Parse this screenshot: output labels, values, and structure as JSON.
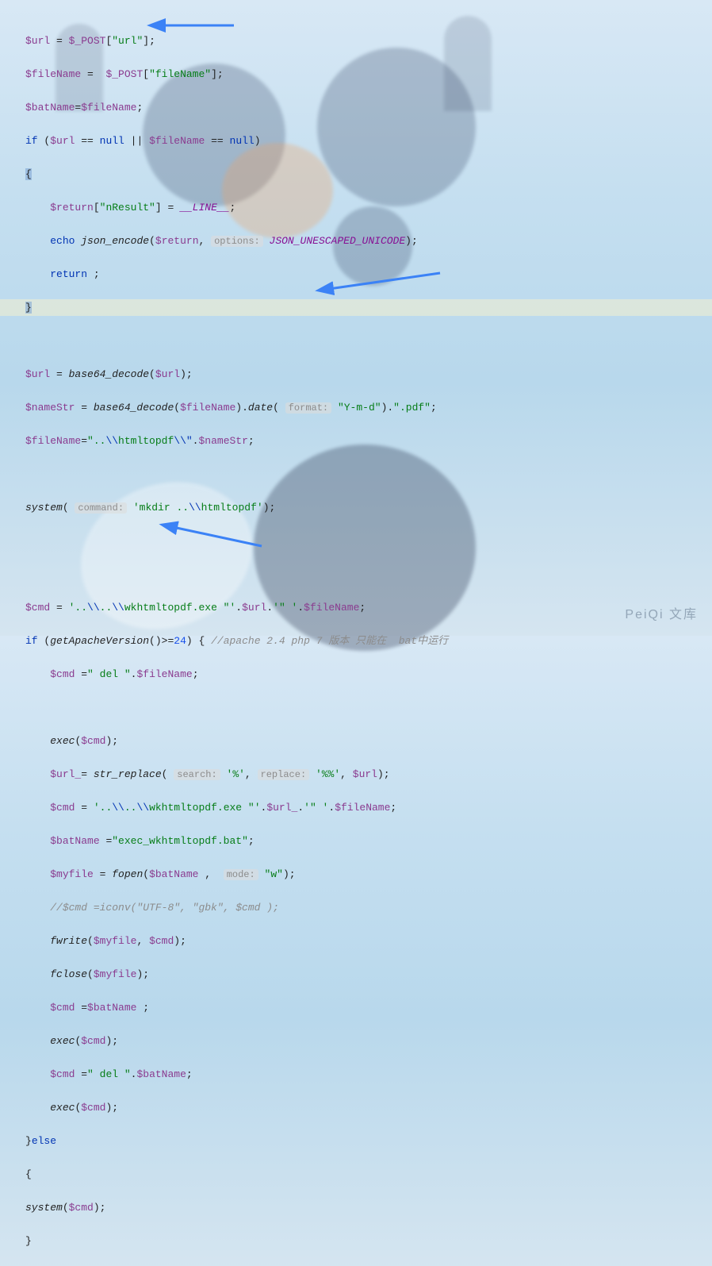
{
  "watermark": "PeiQi 文库",
  "hint_options": "options:",
  "hint_command": "command:",
  "hint_format": "format:",
  "hint_search": "search:",
  "hint_replace": "replace:",
  "hint_mode": "mode:",
  "c": {
    "l1_a": "$url",
    "l1_b": "$_POST",
    "l1_c": "\"url\"",
    "l2_a": "$fileName",
    "l2_b": "$_POST",
    "l2_c": "\"fileName\"",
    "l3_a": "$batName",
    "l3_b": "$fileName",
    "l4_kw": "if",
    "l4_a": "$url",
    "l4_null1": "null",
    "l4_b": "$fileName",
    "l4_null2": "null",
    "l5": "{",
    "l6_a": "$return",
    "l6_b": "\"nResult\"",
    "l6_c": "__LINE__",
    "l7_kw": "echo",
    "l7_fn": "json_encode",
    "l7_a": "$return",
    "l7_b": "JSON_UNESCAPED_UNICODE",
    "l8_kw": "return",
    "l9": "}",
    "l10_a": "$url",
    "l10_fn": "base64_decode",
    "l10_b": "$url",
    "l11_a": "$nameStr",
    "l11_fn": "base64_decode",
    "l11_b": "$fileName",
    "l11_fn2": "date",
    "l11_c": "\"Y-m-d\"",
    "l11_d": "\".pdf\"",
    "l12_a": "$fileName",
    "l12_s": "\"..\\\\htmltopdf\\\\\"",
    "l12_t1": "\"..",
    "l12_t2": "\\\\",
    "l12_t3": "htmltopdf",
    "l12_t4": "\\\\\"",
    "l12_b": "$nameStr",
    "l13_fn": "system",
    "l13_s": "'mkdir ..\\\\htmltopdf'",
    "l13_t1": "'mkdir ..",
    "l13_t2": "\\\\",
    "l13_t3": "htmltopdf'",
    "l14_a": "$cmd",
    "l14_s1": "'..\\\\..\\\\wkhtmltopdf.exe \"'",
    "l14_t1": "'..",
    "l14_t2": "\\\\",
    "l14_t3": "..",
    "l14_t4": "\\\\",
    "l14_t5": "wkhtmltopdf.exe \"'",
    "l14_b": "$url",
    "l14_s2": "'\" '",
    "l14_c": "$fileName",
    "l15_kw": "if",
    "l15_fn": "getApacheVersion",
    "l15_num": "24",
    "l15_cmt": "//apache 2.4 php 7 版本 只能在  bat中运行",
    "l16_a": "$cmd",
    "l16_s": "\" del \"",
    "l16_b": "$fileName",
    "l17_fn": "exec",
    "l17_a": "$cmd",
    "l18_a": "$url_",
    "l18_fn": "str_replace",
    "l18_s1": "'%'",
    "l18_s2": "'%%'",
    "l18_b": "$url",
    "l19_a": "$cmd",
    "l19_t1": "'..",
    "l19_t2": "\\\\",
    "l19_t3": "..",
    "l19_t4": "\\\\",
    "l19_t5": "wkhtmltopdf.exe \"'",
    "l19_b": "$url_",
    "l19_s2": "'\" '",
    "l19_c": "$fileName",
    "l20_a": "$batName",
    "l20_s": "\"exec_wkhtmltopdf.bat\"",
    "l21_a": "$myfile",
    "l21_fn": "fopen",
    "l21_b": "$batName",
    "l21_s": "\"w\"",
    "l22_cmt": "//$cmd =iconv(\"UTF-8\", \"gbk\", $cmd );",
    "l23_fn": "fwrite",
    "l23_a": "$myfile",
    "l23_b": "$cmd",
    "l24_fn": "fclose",
    "l24_a": "$myfile",
    "l25_a": "$cmd",
    "l25_b": "$batName",
    "l26_fn": "exec",
    "l26_a": "$cmd",
    "l27_a": "$cmd",
    "l27_s": "\" del \"",
    "l27_b": "$batName",
    "l28_fn": "exec",
    "l28_a": "$cmd",
    "l29": "}",
    "l29_kw": "else",
    "l30": "{",
    "l31_fn": "system",
    "l31_a": "$cmd",
    "l32": "}"
  }
}
